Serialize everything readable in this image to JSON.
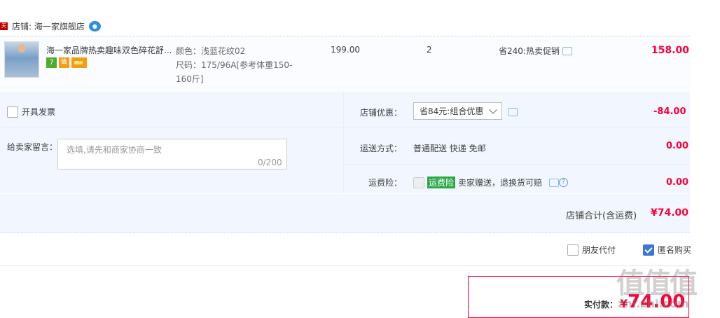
{
  "shop": {
    "badge": "天猫",
    "label": "店铺: 海一家旗舰店"
  },
  "item": {
    "title": "海一家品牌热卖趣味双色碎花舒...",
    "sku_color": "颜色：浅蓝花纹02",
    "sku_size": "尺码：175/96A[参考体重150-160斤]",
    "price": "199.00",
    "quantity": "2",
    "promo": "省240:热卖促销",
    "subtotal": "158.00",
    "badges": [
      "7",
      "蜂",
      "卡"
    ]
  },
  "invoice": {
    "label": "开具发票",
    "checked": false
  },
  "message": {
    "label": "给卖家留言：",
    "placeholder": "选填,请先和商家协商一致",
    "count": "0/200"
  },
  "discount": {
    "label": "店铺优惠：",
    "selected": "省84元:组合优惠",
    "amount": "-84.00"
  },
  "shipping": {
    "label": "运送方式：",
    "value": "普通配送 快递 免邮",
    "amount": "0.00"
  },
  "insurance": {
    "label": "运费险：",
    "tag": "运费险",
    "text": "卖家赠送，退换货可赔",
    "amount": "0.00"
  },
  "total": {
    "label": "店铺合计(含运费)",
    "amount": "¥74.00"
  },
  "options": {
    "friend_pay": "朋友代付",
    "anonymous": "匿名购买"
  },
  "payment": {
    "label": "实付款：",
    "currency": "¥",
    "amount": "74.00"
  },
  "watermark": {
    "main": "值值值",
    "sub": "zhi.zhi.com"
  },
  "colors": {
    "accent": "#ff0036",
    "panel": "#f2f7ff",
    "link": "#3a76d6"
  }
}
